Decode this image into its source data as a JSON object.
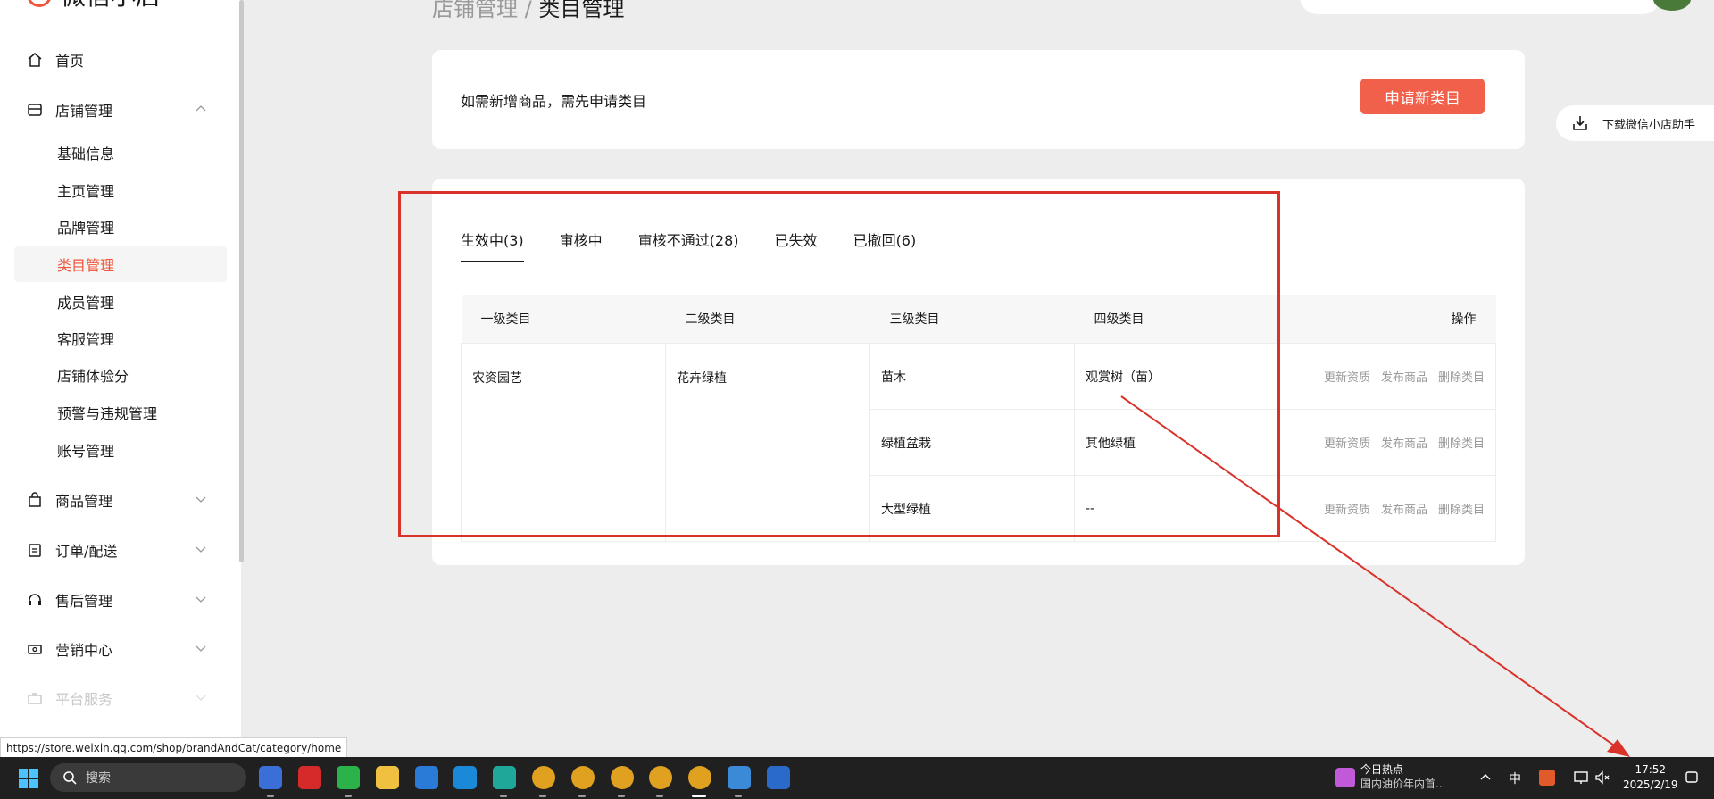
{
  "app": {
    "logo_text": "微信小店"
  },
  "breadcrumb": {
    "parent": "店铺管理",
    "separator": " / ",
    "current": "类目管理"
  },
  "sidebar": {
    "items": [
      {
        "label": "首页",
        "icon": "home-icon"
      },
      {
        "label": "店铺管理",
        "icon": "store-icon",
        "expanded": true
      },
      {
        "label": "商品管理",
        "icon": "bag-icon"
      },
      {
        "label": "订单/配送",
        "icon": "clipboard-icon"
      },
      {
        "label": "售后管理",
        "icon": "headset-icon"
      },
      {
        "label": "营销中心",
        "icon": "ticket-icon"
      },
      {
        "label": "平台服务",
        "icon": "briefcase-icon"
      }
    ],
    "store_sub_items": [
      "基础信息",
      "主页管理",
      "品牌管理",
      "类目管理",
      "成员管理",
      "客服管理",
      "店铺体验分",
      "预警与违规管理",
      "账号管理"
    ],
    "active_sub": "类目管理"
  },
  "notice": {
    "text": "如需新增商品，需先申请类目",
    "apply_button": "申请新类目"
  },
  "download_helper": "下载微信小店助手",
  "tabs": [
    {
      "label": "生效中(3)",
      "active": true
    },
    {
      "label": "审核中"
    },
    {
      "label": "审核不通过(28)"
    },
    {
      "label": "已失效"
    },
    {
      "label": "已撤回(6)"
    }
  ],
  "table": {
    "headers": [
      "一级类目",
      "二级类目",
      "三级类目",
      "四级类目",
      "操作"
    ],
    "level1": "农资园艺",
    "level2": "花卉绿植",
    "rows": [
      {
        "level3": "苗木",
        "level4": "观赏树（苗）"
      },
      {
        "level3": "绿植盆栽",
        "level4": "其他绿植"
      },
      {
        "level3": "大型绿植",
        "level4": "--"
      }
    ],
    "actions": [
      "更新资质",
      "发布商品",
      "删除类目"
    ]
  },
  "status_url": "https://store.weixin.qq.com/shop/brandAndCat/category/home",
  "taskbar": {
    "search_placeholder": "搜索",
    "news_title": "今日热点",
    "news_text": "国内油价年内首...",
    "ime": "中",
    "time": "17:52",
    "date": "2025/2/19"
  },
  "colors": {
    "accent": "#f0553a",
    "annotation": "#d8322a"
  }
}
